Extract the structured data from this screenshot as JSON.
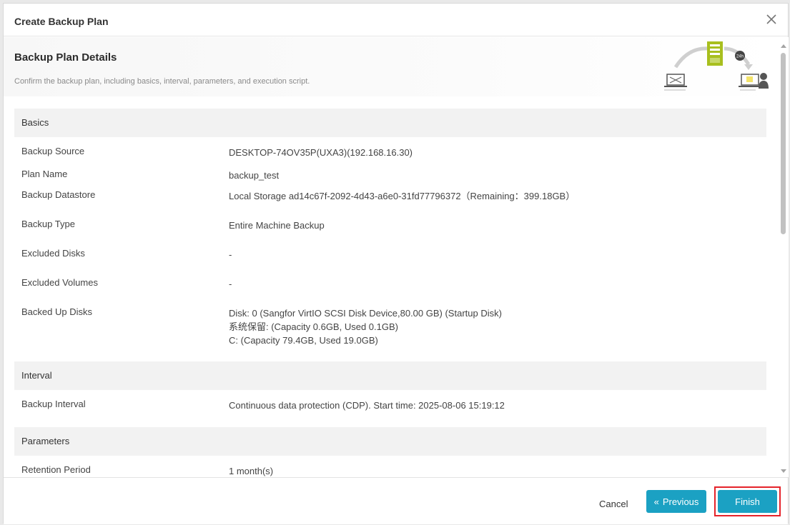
{
  "dialog": {
    "title": "Create Backup Plan"
  },
  "header": {
    "title": "Backup Plan Details",
    "description": "Confirm the backup plan, including basics, interval, parameters, and execution script.",
    "illustration_badge": "24h"
  },
  "groups": {
    "basics": {
      "title": "Basics",
      "rows": [
        {
          "label": "Backup Source",
          "values": [
            "DESKTOP-74OV35P(UXA3)(192.168.16.30)"
          ]
        },
        {
          "label": "Plan Name",
          "values": [
            "backup_test"
          ]
        },
        {
          "label": "Backup Datastore",
          "values": [
            "Local Storage ad14c67f-2092-4d43-a6e0-31fd77796372（Remaining：399.18GB）"
          ]
        },
        {
          "label": "Backup Type",
          "values": [
            "Entire Machine Backup"
          ]
        },
        {
          "label": "Excluded Disks",
          "values": [
            "-"
          ]
        },
        {
          "label": "Excluded Volumes",
          "values": [
            "-"
          ]
        },
        {
          "label": "Backed Up Disks",
          "values": [
            "Disk: 0 (Sangfor VirtIO SCSI Disk Device,80.00 GB) (Startup Disk)",
            "系统保留: (Capacity 0.6GB, Used 0.1GB)",
            "C: (Capacity 79.4GB, Used 19.0GB)"
          ]
        }
      ]
    },
    "interval": {
      "title": "Interval",
      "rows": [
        {
          "label": "Backup Interval",
          "values": [
            "Continuous data protection (CDP). Start time: 2025-08-06 15:19:12"
          ]
        }
      ]
    },
    "parameters": {
      "title": "Parameters",
      "rows": [
        {
          "label": "Retention Period",
          "values": [
            "1 month(s)"
          ]
        }
      ]
    }
  },
  "footer": {
    "cancel_label": "Cancel",
    "previous_label": "Previous",
    "previous_icon": "«",
    "finish_label": "Finish"
  },
  "colors": {
    "primary": "#1ba1c3",
    "highlight_border": "#e5232a",
    "accent_green": "#a8bf1e"
  }
}
